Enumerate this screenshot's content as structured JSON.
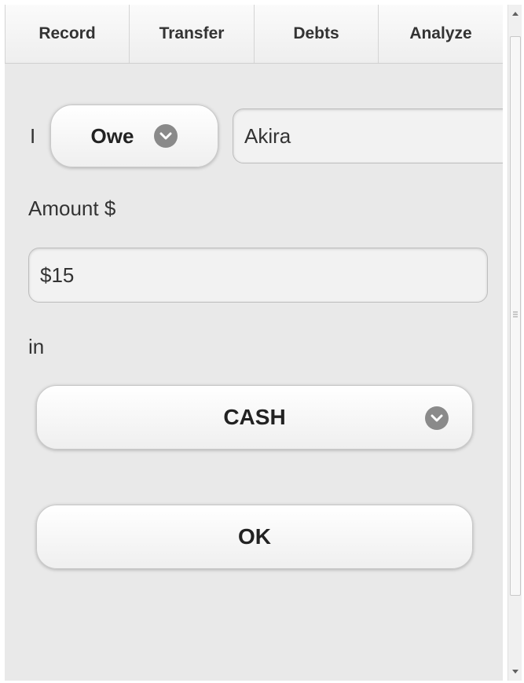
{
  "tabs": [
    {
      "label": "Record"
    },
    {
      "label": "Transfer"
    },
    {
      "label": "Debts"
    },
    {
      "label": "Analyze"
    }
  ],
  "form": {
    "subject_label": "I",
    "relation_value": "Owe",
    "person_value": "Akira",
    "amount_label": "Amount $",
    "amount_value": "$15",
    "in_label": "in",
    "account_value": "CASH",
    "ok_label": "OK"
  },
  "icons": {
    "dropdown": "chevron-down-icon",
    "scroll_up": "arrow-up-icon",
    "scroll_down": "arrow-down-icon"
  },
  "colors": {
    "background": "#e9e9e9",
    "chevron": "#8a8a8a",
    "text": "#333333"
  }
}
